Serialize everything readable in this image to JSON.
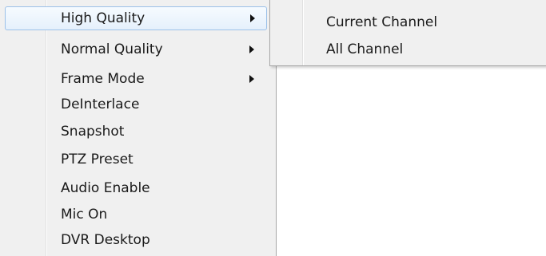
{
  "context_menu": {
    "items": [
      {
        "label": "High Quality",
        "has_submenu": true,
        "highlighted": true
      },
      {
        "label": "Normal Quality",
        "has_submenu": true,
        "highlighted": false
      },
      {
        "label": "Frame Mode",
        "has_submenu": true,
        "highlighted": false
      },
      {
        "label": "DeInterlace",
        "has_submenu": false,
        "highlighted": false
      },
      {
        "label": "Snapshot",
        "has_submenu": false,
        "highlighted": false
      },
      {
        "label": "PTZ Preset",
        "has_submenu": false,
        "highlighted": false
      },
      {
        "label": "Audio Enable",
        "has_submenu": false,
        "highlighted": false
      },
      {
        "label": "Mic On",
        "has_submenu": false,
        "highlighted": false
      },
      {
        "label": "DVR Desktop",
        "has_submenu": false,
        "highlighted": false
      }
    ]
  },
  "submenu": {
    "items": [
      {
        "label": "Current Channel"
      },
      {
        "label": "All Channel"
      }
    ]
  },
  "colors": {
    "menu_bg": "#f0f0f0",
    "highlight_border": "#9cc1e8",
    "highlight_bg": "#e5f0fb",
    "border": "#a7a7a7"
  }
}
